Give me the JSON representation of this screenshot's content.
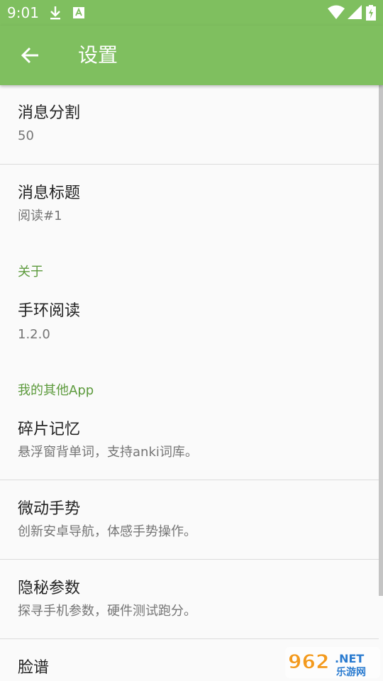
{
  "status_bar": {
    "time": "9:01"
  },
  "app_bar": {
    "title": "设置"
  },
  "items": [
    {
      "title": "消息分割",
      "subtitle": "50"
    },
    {
      "title": "消息标题",
      "subtitle": "阅读#1"
    },
    {
      "title": "手环阅读",
      "subtitle": "1.2.0"
    },
    {
      "title": "碎片记忆",
      "subtitle": "悬浮窗背单词，支持anki词库。"
    },
    {
      "title": "微动手势",
      "subtitle": "创新安卓导航，体感手势操作。"
    },
    {
      "title": "隐秘参数",
      "subtitle": "探寻手机参数，硬件测试跑分。"
    },
    {
      "title": "脸谱"
    }
  ],
  "categories": {
    "about": "关于",
    "other_apps": "我的其他App"
  },
  "watermark": {
    "number": "962",
    "suffix": ".NET",
    "site": "乐游网"
  },
  "colors": {
    "primary": "#7fbf5f",
    "category": "#5c9a3c",
    "background": "#fafafa"
  },
  "icons": {
    "status_bar": [
      "download-icon",
      "font-a-icon",
      "wifi-icon",
      "signal-icon",
      "battery-icon"
    ],
    "app_bar": [
      "back-arrow-icon"
    ]
  }
}
